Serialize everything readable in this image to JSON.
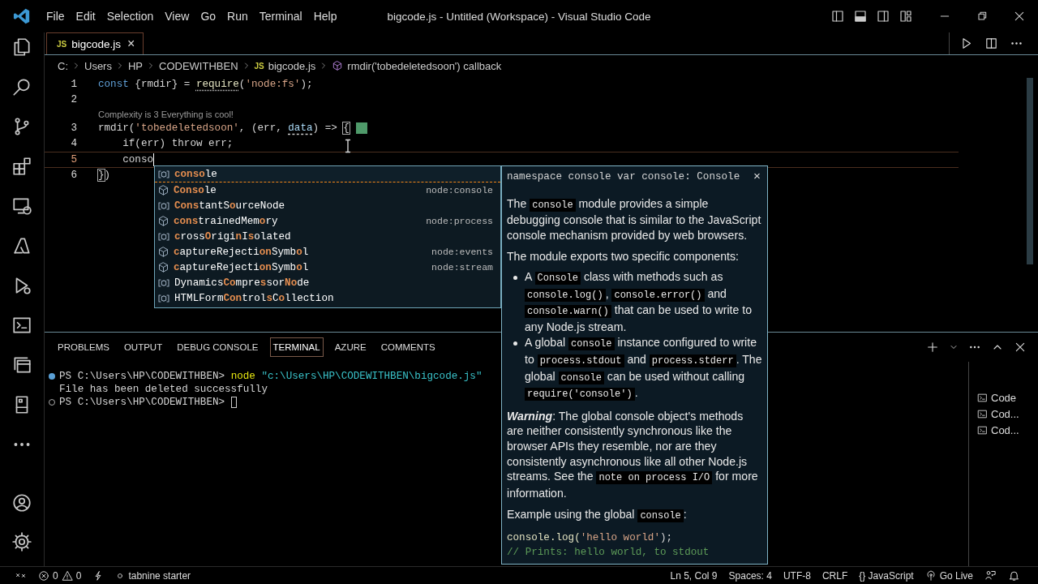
{
  "window": {
    "title": "bigcode.js - Untitled (Workspace) - Visual Studio Code"
  },
  "menu": [
    "File",
    "Edit",
    "Selection",
    "View",
    "Go",
    "Run",
    "Terminal",
    "Help"
  ],
  "tabs": [
    {
      "badge": "JS",
      "label": "bigcode.js",
      "close": "×",
      "selected": true
    }
  ],
  "breadcrumb": [
    {
      "kind": "folder",
      "label": "C:"
    },
    {
      "kind": "folder",
      "label": "Users"
    },
    {
      "kind": "folder",
      "label": "HP"
    },
    {
      "kind": "folder",
      "label": "CODEWITHBEN"
    },
    {
      "kind": "file",
      "badge": "JS",
      "label": "bigcode.js"
    },
    {
      "kind": "symbol",
      "label": "rmdir('tobedeletedsoon') callback"
    }
  ],
  "editor": {
    "lines": [
      {
        "number": "1",
        "active": false,
        "tokens": [
          {
            "kind": "kw",
            "text": "const"
          },
          {
            "kind": "plain",
            "text": " {rmdir} = "
          },
          {
            "kind": "fn",
            "text": "require",
            "hint": true
          },
          {
            "kind": "plain",
            "text": "("
          },
          {
            "kind": "str",
            "text": "'node:fs'"
          },
          {
            "kind": "plain",
            "text": ");"
          }
        ]
      },
      {
        "number": "2",
        "active": false
      },
      {
        "number": "3",
        "active": false,
        "codelens": "Complexity is 3 Everything is cool!",
        "marker": true,
        "tokens": [
          {
            "kind": "plain",
            "text": "rmdir("
          },
          {
            "kind": "str",
            "text": "'tobedeletedsoon'"
          },
          {
            "kind": "plain",
            "text": ", (err, "
          },
          {
            "kind": "var",
            "text": "data",
            "hint": true
          },
          {
            "kind": "plain",
            "text": ") => "
          },
          {
            "kind": "bracket",
            "text": "{"
          }
        ]
      },
      {
        "number": "4",
        "active": false,
        "tokens": [
          {
            "kind": "ctl",
            "text": "    if"
          },
          {
            "kind": "plain",
            "text": "(err) "
          },
          {
            "kind": "ctl",
            "text": "throw"
          },
          {
            "kind": "plain",
            "text": " err;"
          }
        ]
      },
      {
        "number": "5",
        "active": true,
        "tokens": [
          {
            "kind": "plain",
            "text": "    conso"
          }
        ]
      },
      {
        "number": "6",
        "active": false,
        "tokens": [
          {
            "kind": "bracket",
            "text": "}"
          },
          {
            "kind": "plain",
            "text": ")"
          }
        ]
      }
    ]
  },
  "suggest": {
    "items": [
      {
        "kind": "variable",
        "parts": [
          {
            "text": "conso",
            "match": true
          },
          {
            "text": "le",
            "match": false
          }
        ],
        "selected": true
      },
      {
        "kind": "module",
        "parts": [
          {
            "text": "Conso",
            "match": true
          },
          {
            "text": "le",
            "match": false
          }
        ],
        "detail": "node:console",
        "selected": false
      },
      {
        "kind": "variable",
        "parts": [
          {
            "text": "Cons",
            "match": true
          },
          {
            "text": "tantS",
            "match": false
          },
          {
            "text": "o",
            "match": true
          },
          {
            "text": "urceNode",
            "match": false
          }
        ],
        "selected": false
      },
      {
        "kind": "module",
        "parts": [
          {
            "text": "cons",
            "match": true
          },
          {
            "text": "trainedMem",
            "match": false
          },
          {
            "text": "o",
            "match": true
          },
          {
            "text": "ry",
            "match": false
          }
        ],
        "detail": "node:process",
        "selected": false
      },
      {
        "kind": "variable",
        "parts": [
          {
            "text": "c",
            "match": true
          },
          {
            "text": "ross",
            "match": false
          },
          {
            "text": "O",
            "match": true
          },
          {
            "text": "rigi",
            "match": false
          },
          {
            "text": "n",
            "match": true
          },
          {
            "text": "I",
            "match": false
          },
          {
            "text": "s",
            "match": true
          },
          {
            "text": "olated",
            "match": false
          }
        ],
        "selected": false
      },
      {
        "kind": "module",
        "parts": [
          {
            "text": "c",
            "match": true
          },
          {
            "text": "aptureRejecti",
            "match": false
          },
          {
            "text": "on",
            "match": true
          },
          {
            "text": "S",
            "match": false
          },
          {
            "text": "ymb",
            "match": false
          },
          {
            "text": "o",
            "match": true
          },
          {
            "text": "l",
            "match": false
          }
        ],
        "detail": "node:events",
        "selected": false
      },
      {
        "kind": "module",
        "parts": [
          {
            "text": "c",
            "match": true
          },
          {
            "text": "aptureRejecti",
            "match": false
          },
          {
            "text": "on",
            "match": true
          },
          {
            "text": "S",
            "match": false
          },
          {
            "text": "ymb",
            "match": false
          },
          {
            "text": "o",
            "match": true
          },
          {
            "text": "l",
            "match": false
          }
        ],
        "detail": "node:stream",
        "selected": false
      },
      {
        "kind": "variable",
        "parts": [
          {
            "text": "Dynamics",
            "match": false
          },
          {
            "text": "Co",
            "match": true
          },
          {
            "text": "mpre",
            "match": false
          },
          {
            "text": "s",
            "match": true
          },
          {
            "text": "sor",
            "match": false
          },
          {
            "text": "No",
            "match": true
          },
          {
            "text": "de",
            "match": false
          }
        ],
        "selected": false
      },
      {
        "kind": "variable",
        "parts": [
          {
            "text": "HTMLForm",
            "match": false
          },
          {
            "text": "Con",
            "match": true
          },
          {
            "text": "trol",
            "match": false
          },
          {
            "text": "s",
            "match": true
          },
          {
            "text": "C",
            "match": false
          },
          {
            "text": "o",
            "match": true
          },
          {
            "text": "llection",
            "match": false
          }
        ],
        "selected": false
      }
    ]
  },
  "hover": {
    "signature": "namespace console var console: Console",
    "close": "×",
    "blocks": [
      {
        "kind": "paragraph",
        "parts": [
          "The ",
          "console",
          " module provides a simple debugging console that is similar to the JavaScript console mechanism provided by web browsers."
        ]
      },
      {
        "kind": "paragraph",
        "parts": [
          "The module exports two specific components:"
        ]
      },
      {
        "kind": "list",
        "items": [
          [
            "A ",
            "Console",
            " class with methods such as ",
            "console.log()",
            ", ",
            "console.error()",
            " and ",
            "console.warn()",
            " that can be used to write to any Node.js stream."
          ],
          [
            "A global ",
            "console",
            " instance configured to write to ",
            "process.stdout",
            " and ",
            "process.stderr",
            ". The global ",
            "console",
            " can be used without calling ",
            "require('console')",
            "."
          ]
        ]
      },
      {
        "kind": "paragraph",
        "parts": [
          "**Warning**: The global console object's methods are neither consistently synchronous like the browser APIs they resemble, nor are they consistently asynchronous like all other Node.js streams. See the ",
          "note on process I/O",
          " for more information."
        ]
      },
      {
        "kind": "paragraph",
        "parts": [
          "Example using the global ",
          "console",
          ":"
        ]
      },
      {
        "kind": "code",
        "lines": [
          [
            {
              "kind": "fn",
              "text": "console.log("
            },
            {
              "kind": "str",
              "text": "'hello world'"
            },
            {
              "kind": "plain",
              "text": ");"
            }
          ],
          [
            {
              "kind": "comment",
              "text": "// Prints: hello world, to stdout"
            }
          ]
        ]
      }
    ]
  },
  "panel": {
    "tabs": [
      {
        "label": "PROBLEMS",
        "selected": false
      },
      {
        "label": "OUTPUT",
        "selected": false
      },
      {
        "label": "DEBUG CONSOLE",
        "selected": false
      },
      {
        "label": "TERMINAL",
        "selected": true
      },
      {
        "label": "AZURE",
        "selected": false
      },
      {
        "label": "COMMENTS",
        "selected": false
      }
    ],
    "terminal": [
      {
        "kind": "filled",
        "tokens": [
          {
            "kind": "plain",
            "text": "PS C:\\Users\\HP\\CODEWITHBEN> "
          },
          {
            "kind": "cmd",
            "text": "node"
          },
          {
            "kind": "tstr",
            "text": " \"c:\\Users\\HP\\CODEWITHBEN\\bigcode.js\""
          }
        ]
      },
      {
        "tokens": [
          {
            "kind": "plain",
            "text": "File has been deleted successfully"
          }
        ]
      },
      {
        "kind": "hollow",
        "cursor": true,
        "tokens": [
          {
            "kind": "plain",
            "text": "PS C:\\Users\\HP\\CODEWITHBEN> "
          }
        ]
      }
    ],
    "terminals": [
      {
        "label": "Code"
      },
      {
        "label": "Cod..."
      },
      {
        "label": "Cod..."
      }
    ]
  },
  "status_bar": {
    "errors": "0",
    "warnings": "0",
    "extension": "tabnine starter",
    "right": [
      {
        "kind": "text",
        "label": "Ln 5, Col 9"
      },
      {
        "kind": "text",
        "label": "Spaces: 4"
      },
      {
        "kind": "text",
        "label": "UTF-8"
      },
      {
        "kind": "text",
        "label": "CRLF"
      },
      {
        "kind": "text",
        "label": "{} JavaScript"
      },
      {
        "kind": "live",
        "label": "Go Live"
      },
      {
        "kind": "feedback"
      },
      {
        "kind": "bell"
      }
    ]
  }
}
